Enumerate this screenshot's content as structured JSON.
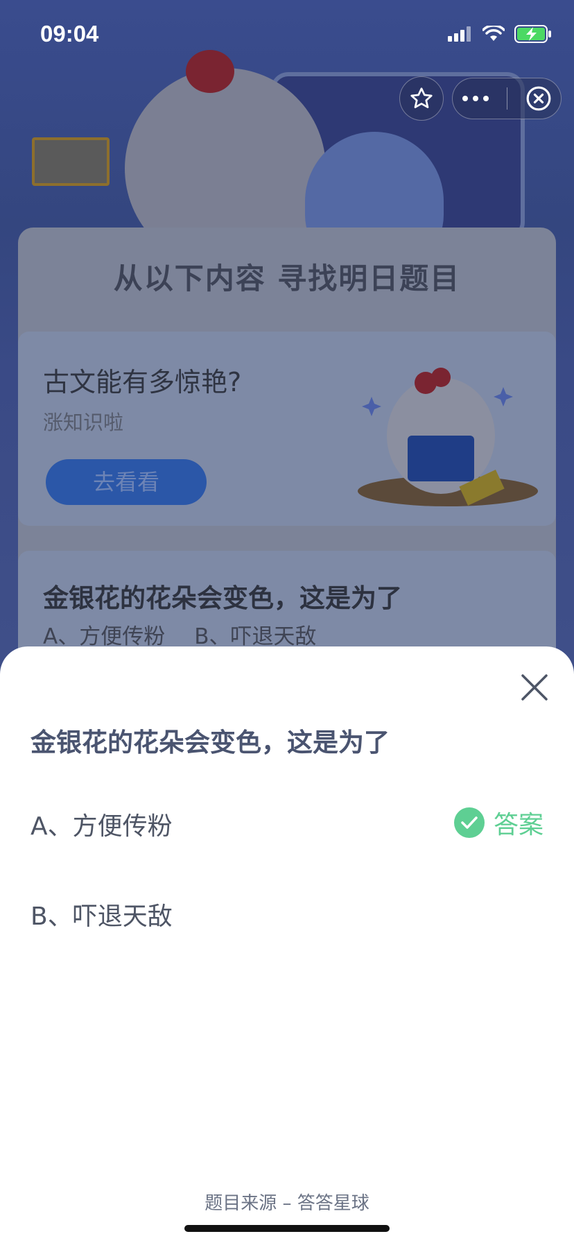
{
  "status_bar": {
    "time": "09:04"
  },
  "background": {
    "panel_title": "从以下内容 寻找明日题目",
    "card1": {
      "title": "古文能有多惊艳?",
      "subtitle": "涨知识啦",
      "button": "去看看"
    },
    "card2": {
      "title": "金银花的花朵会变色，这是为了",
      "option_a": "A、方便传粉",
      "option_b": "B、吓退天敌"
    }
  },
  "sheet": {
    "question": "金银花的花朵会变色，这是为了",
    "options": [
      {
        "label": "A、方便传粉",
        "is_answer": true
      },
      {
        "label": "B、吓退天敌",
        "is_answer": false
      }
    ],
    "answer_label": "答案",
    "source": "题目来源 – 答答星球"
  },
  "colors": {
    "answer_green": "#5ecf93",
    "title_color": "#4a5470"
  },
  "icons": [
    "signal-icon",
    "wifi-icon",
    "battery-charging-icon",
    "star-icon",
    "more-icon",
    "close-circle-icon",
    "close-icon",
    "check-circle-icon"
  ]
}
